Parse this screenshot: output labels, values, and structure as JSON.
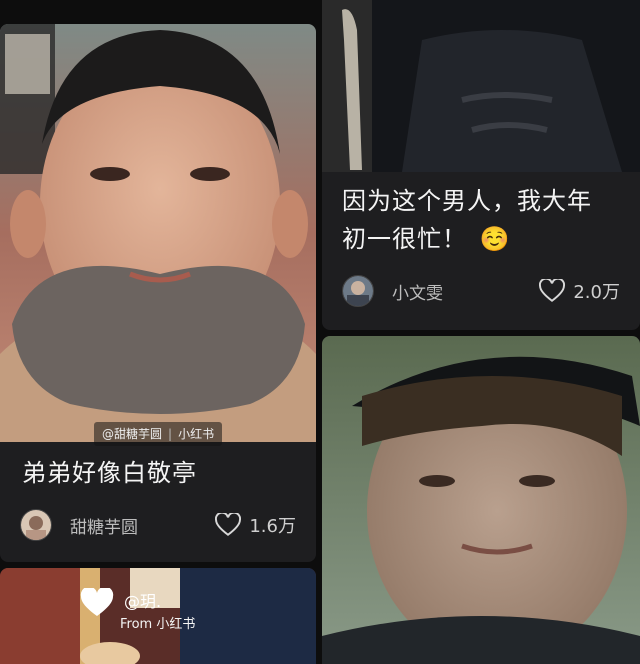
{
  "feed": {
    "cards": [
      {
        "title": "弟弟好像白敬亭",
        "author": "甜糖芋圆",
        "likes": "1.6万",
        "watermark": {
          "handle": "@甜糖芋圆",
          "brand": "小红书"
        }
      },
      {
        "title_line1": "因为这个男人，我大年",
        "title_line2": "初一很忙！",
        "emoji": "☺️",
        "author": "小文雯",
        "likes": "2.0万"
      },
      {
        "author_handle": "@玥.",
        "from_text": "From 小红书"
      }
    ]
  },
  "colors": {
    "background": "#0d0d0d",
    "card": "#1e1e20",
    "text": "#f4f4f4",
    "muted": "#bdbdbd"
  }
}
